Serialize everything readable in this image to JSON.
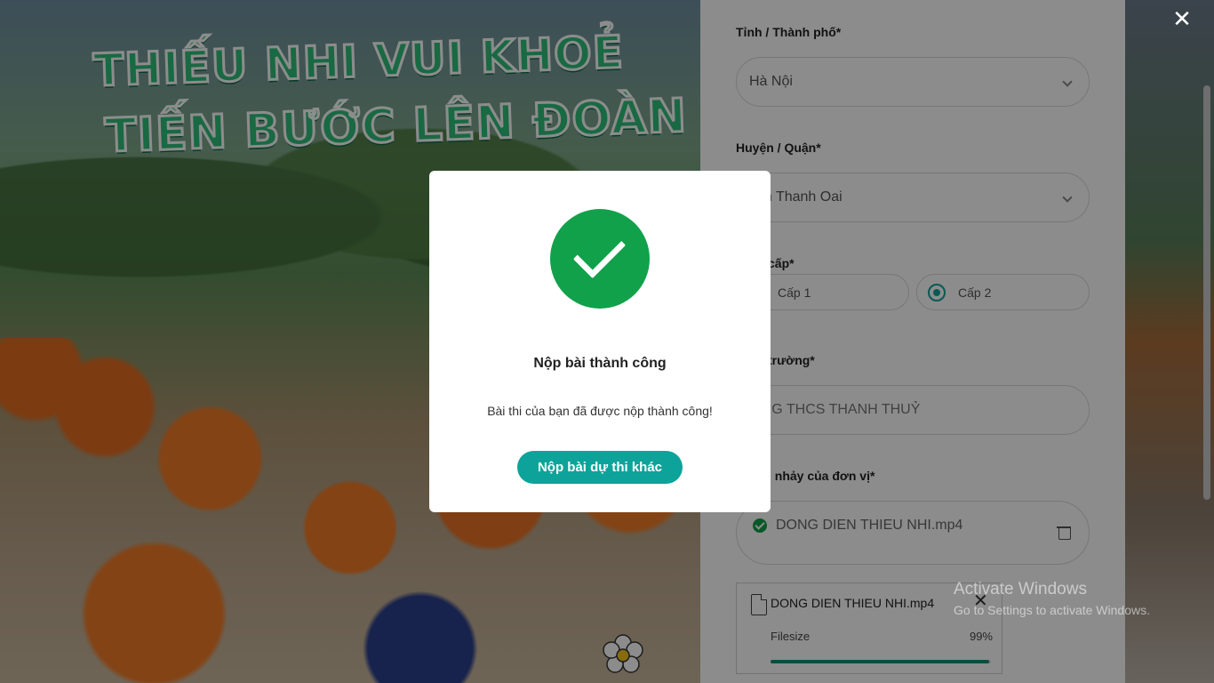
{
  "hero": {
    "title_line1": "THIẾU NHI VUI KHOẺ",
    "title_line2": "TIẾN BƯỚC LÊN ĐOÀN"
  },
  "form": {
    "province": {
      "label": "Tỉnh / Thành phố*",
      "value": "Hà Nội"
    },
    "district": {
      "label": "Huyện / Quận*",
      "value": "yện Thanh Oai"
    },
    "level": {
      "label": "cấp*",
      "options": [
        "Cấp 1",
        "Cấp 2"
      ],
      "selected": "Cấp 2"
    },
    "school": {
      "label": "trường*",
      "value": "ỜNG THCS THANH THUỶ"
    },
    "video": {
      "label": "i nhảy của đơn vị*",
      "uploaded_file": "DONG DIEN THIEU NHI.mp4"
    },
    "upload_card": {
      "file_name": "DONG DIEN THIEU NHI.mp4",
      "size_label": "Filesize",
      "progress_text": "99%",
      "progress": 0.99
    }
  },
  "modal": {
    "icon": "check-circle-icon",
    "title": "Nộp bài thành công",
    "message": "Bài thi của bạn đã được nộp thành công!",
    "button_label": "Nộp bài dự thi khác"
  },
  "close_label": "✕",
  "watermark": {
    "line1": "Activate Windows",
    "line2": "Go to Settings to activate Windows."
  },
  "colors": {
    "primary": "#0ea39a",
    "success": "#11a14a",
    "progress": "#0e8f74"
  }
}
